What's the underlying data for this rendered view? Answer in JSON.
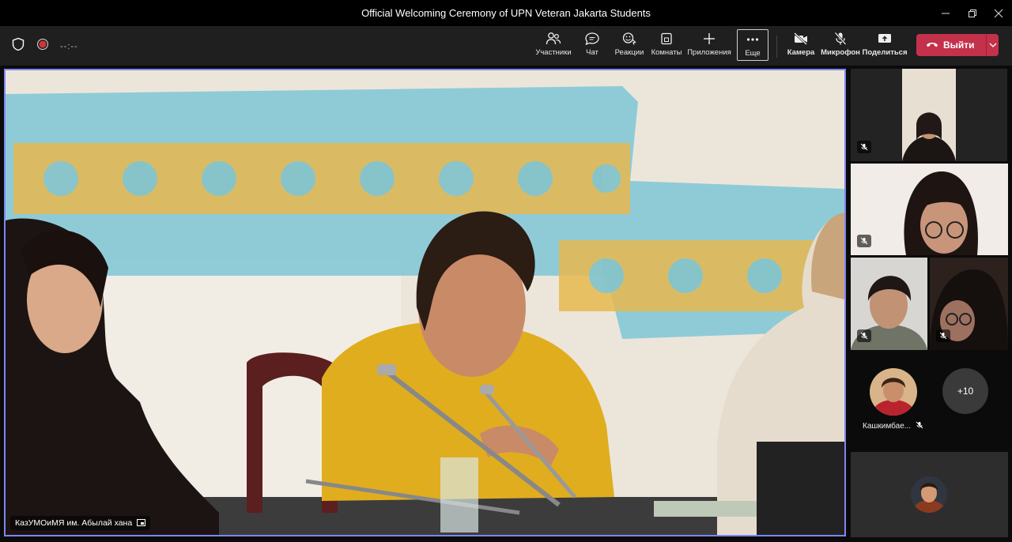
{
  "window": {
    "title": "Official Welcoming Ceremony of UPN Veteran Jakarta Students"
  },
  "toolbar": {
    "timer": "--:--",
    "participants": "Участники",
    "chat": "Чат",
    "reactions": "Реакции",
    "rooms": "Комнаты",
    "apps": "Приложения",
    "more": "Еще",
    "camera": "Камера",
    "mic": "Микрофон",
    "share": "Поделиться",
    "leave": "Выйти"
  },
  "main_video": {
    "speaker_name": "КазУМОиМЯ им. Абылай хана"
  },
  "participants_panel": {
    "avatar_name": "Кашкимбае...",
    "overflow_count": "+10"
  },
  "colors": {
    "accent": "#7f85f5",
    "leave": "#c4314b"
  }
}
